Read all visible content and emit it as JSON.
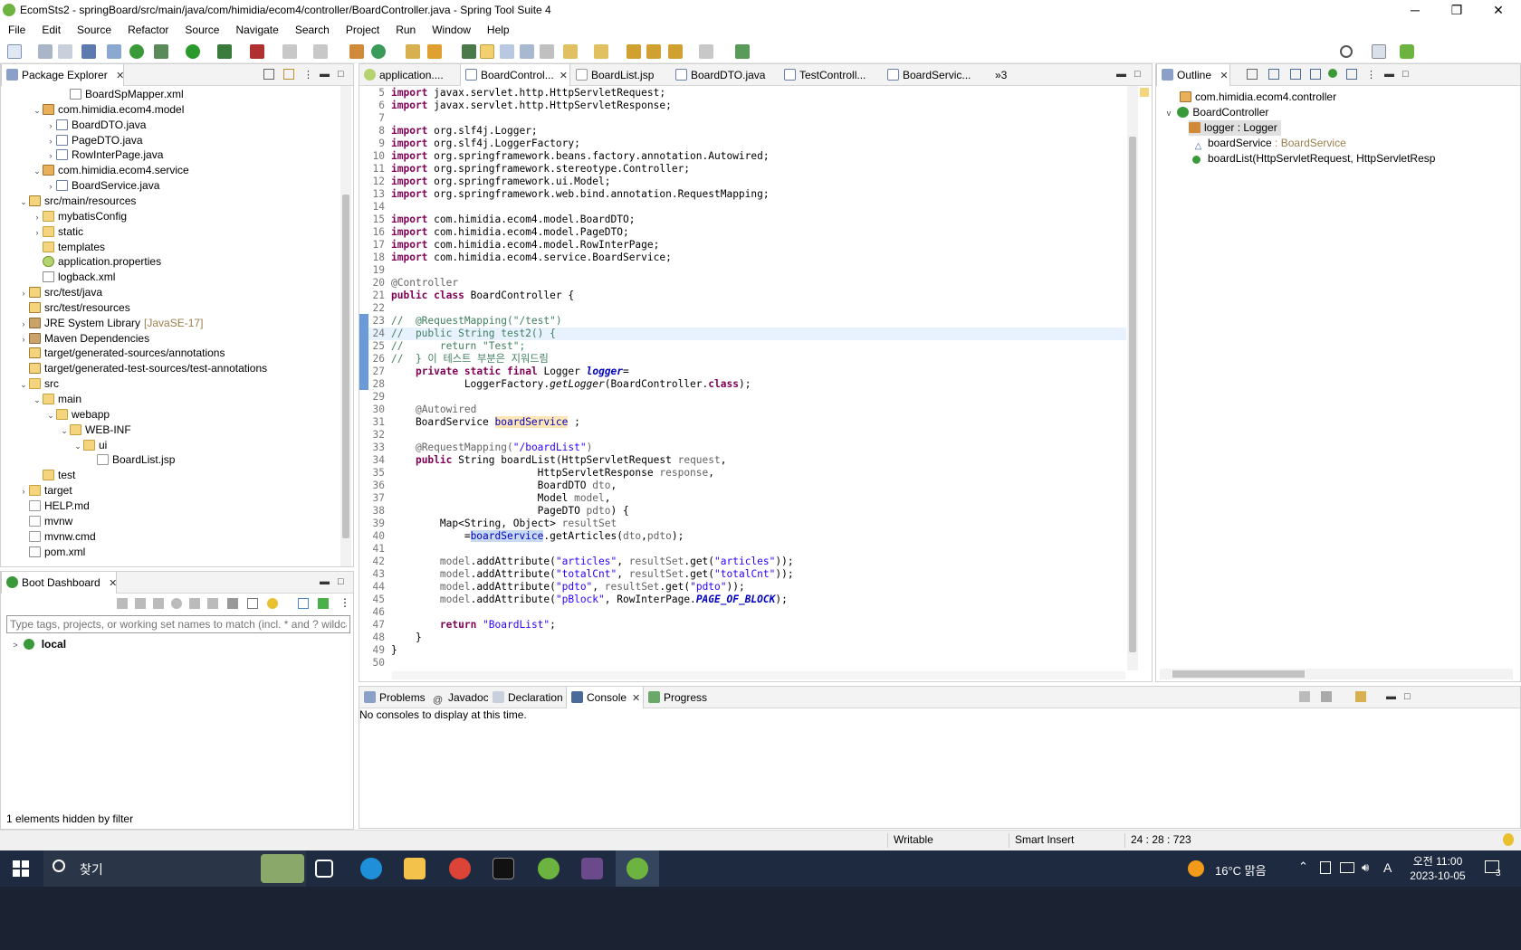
{
  "window": {
    "title": "EcomSts2 - springBoard/src/main/java/com/himidia/ecom4/controller/BoardController.java - Spring Tool Suite 4",
    "minimize": "─",
    "maximize": "❐",
    "close": "✕"
  },
  "menu": [
    "File",
    "Edit",
    "Source",
    "Refactor",
    "Source",
    "Navigate",
    "Search",
    "Project",
    "Run",
    "Window",
    "Help"
  ],
  "package_explorer": {
    "title": "Package Explorer",
    "rows": [
      {
        "label": "BoardSpMapper.xml",
        "indent": 4,
        "icon": "xml",
        "tw": ""
      },
      {
        "label": "com.himidia.ecom4.model",
        "indent": 2,
        "icon": "pkg",
        "tw": "v"
      },
      {
        "label": "BoardDTO.java",
        "indent": 3,
        "icon": "java",
        "tw": ">"
      },
      {
        "label": "PageDTO.java",
        "indent": 3,
        "icon": "java",
        "tw": ">"
      },
      {
        "label": "RowInterPage.java",
        "indent": 3,
        "icon": "java",
        "tw": ">"
      },
      {
        "label": "com.himidia.ecom4.service",
        "indent": 2,
        "icon": "pkg",
        "tw": "v"
      },
      {
        "label": "BoardService.java",
        "indent": 3,
        "icon": "java",
        "tw": ">"
      },
      {
        "label": "src/main/resources",
        "indent": 1,
        "icon": "src",
        "tw": "v"
      },
      {
        "label": "mybatisConfig",
        "indent": 2,
        "icon": "folder",
        "tw": ">"
      },
      {
        "label": "static",
        "indent": 2,
        "icon": "folder",
        "tw": ">"
      },
      {
        "label": "templates",
        "indent": 2,
        "icon": "folder",
        "tw": ""
      },
      {
        "label": "application.properties",
        "indent": 2,
        "icon": "prop",
        "tw": ""
      },
      {
        "label": "logback.xml",
        "indent": 2,
        "icon": "xml",
        "tw": ""
      },
      {
        "label": "src/test/java",
        "indent": 1,
        "icon": "src",
        "tw": ">"
      },
      {
        "label": "src/test/resources",
        "indent": 1,
        "icon": "src",
        "tw": ""
      },
      {
        "label": "JRE System Library",
        "suffix": "[JavaSE-17]",
        "indent": 1,
        "icon": "lib",
        "tw": ">"
      },
      {
        "label": "Maven Dependencies",
        "indent": 1,
        "icon": "lib",
        "tw": ">"
      },
      {
        "label": "target/generated-sources/annotations",
        "indent": 1,
        "icon": "src",
        "tw": ""
      },
      {
        "label": "target/generated-test-sources/test-annotations",
        "indent": 1,
        "icon": "src",
        "tw": ""
      },
      {
        "label": "src",
        "indent": 1,
        "icon": "folder",
        "tw": "v"
      },
      {
        "label": "main",
        "indent": 2,
        "icon": "folder",
        "tw": "v"
      },
      {
        "label": "webapp",
        "indent": 3,
        "icon": "folder",
        "tw": "v"
      },
      {
        "label": "WEB-INF",
        "indent": 4,
        "icon": "folder",
        "tw": "v"
      },
      {
        "label": "ui",
        "indent": 5,
        "icon": "folder",
        "tw": "v"
      },
      {
        "label": "BoardList.jsp",
        "indent": 6,
        "icon": "file",
        "tw": ""
      },
      {
        "label": "test",
        "indent": 2,
        "icon": "folder",
        "tw": ""
      },
      {
        "label": "target",
        "indent": 1,
        "icon": "folder",
        "tw": ">"
      },
      {
        "label": "HELP.md",
        "indent": 1,
        "icon": "file",
        "tw": ""
      },
      {
        "label": "mvnw",
        "indent": 1,
        "icon": "file",
        "tw": ""
      },
      {
        "label": "mvnw.cmd",
        "indent": 1,
        "icon": "file",
        "tw": ""
      },
      {
        "label": "pom.xml",
        "indent": 1,
        "icon": "xml",
        "tw": ""
      }
    ]
  },
  "boot_dashboard": {
    "title": "Boot Dashboard",
    "filter_placeholder": "Type tags, projects, or working set names to match (incl. * and ? wildcards)",
    "local": "local",
    "footer": "1 elements hidden by filter"
  },
  "editor_tabs": [
    "application....",
    "BoardControl...",
    "BoardList.jsp",
    "BoardDTO.java",
    "TestControll...",
    "BoardServic...",
    "»3"
  ],
  "code": [
    {
      "n": "5",
      "h": "<span class='kw'>import</span> javax.servlet.http.HttpServletRequest;"
    },
    {
      "n": "6",
      "h": "<span class='kw'>import</span> javax.servlet.http.HttpServletResponse;"
    },
    {
      "n": "7",
      "h": ""
    },
    {
      "n": "8",
      "h": "<span class='kw'>import</span> org.slf4j.Logger;"
    },
    {
      "n": "9",
      "h": "<span class='kw'>import</span> org.slf4j.LoggerFactory;"
    },
    {
      "n": "10",
      "h": "<span class='kw'>import</span> org.springframework.beans.factory.annotation.Autowired;"
    },
    {
      "n": "11",
      "h": "<span class='kw'>import</span> org.springframework.stereotype.Controller;"
    },
    {
      "n": "12",
      "h": "<span class='kw'>import</span> org.springframework.ui.Model;"
    },
    {
      "n": "13",
      "h": "<span class='kw'>import</span> org.springframework.web.bind.annotation.RequestMapping;"
    },
    {
      "n": "14",
      "h": ""
    },
    {
      "n": "15",
      "h": "<span class='kw'>import</span> com.himidia.ecom4.model.BoardDTO;"
    },
    {
      "n": "16",
      "h": "<span class='kw'>import</span> com.himidia.ecom4.model.PageDTO;"
    },
    {
      "n": "17",
      "h": "<span class='kw'>import</span> com.himidia.ecom4.model.RowInterPage;"
    },
    {
      "n": "18",
      "h": "<span class='kw'>import</span> com.himidia.ecom4.service.BoardService;"
    },
    {
      "n": "19",
      "h": ""
    },
    {
      "n": "20",
      "h": "<span class='an'>@Controller</span>"
    },
    {
      "n": "21",
      "h": "<span class='kw'>public</span> <span class='kw'>class</span> BoardController {"
    },
    {
      "n": "22",
      "h": ""
    },
    {
      "n": "23",
      "h": "<span class='cm'>//  @RequestMapping(\"/test\")</span>"
    },
    {
      "n": "24",
      "h": "<span class='cm'>//  public String test2() {</span>",
      "cur": true
    },
    {
      "n": "25",
      "h": "<span class='cm'>//      return \"Test\";</span>"
    },
    {
      "n": "26",
      "h": "<span class='cm'>//  } 이 테스트 부분은 지워드림</span>"
    },
    {
      "n": "27",
      "h": "    <span class='kw'>private</span> <span class='kw'>static</span> <span class='kw'>final</span> Logger <span class='sfld'>logger</span>="
    },
    {
      "n": "28",
      "h": "            LoggerFactory.<span class='it'>getLogger</span>(BoardController.<span class='kw'>class</span>);"
    },
    {
      "n": "29",
      "h": ""
    },
    {
      "n": "30",
      "h": "    <span class='an'>@Autowired</span>"
    },
    {
      "n": "31",
      "h": "    BoardService <span class='fld hl'>boardService</span> ;"
    },
    {
      "n": "32",
      "h": ""
    },
    {
      "n": "33",
      "h": "    <span class='an'>@RequestMapping(</span><span class='st'>\"/boardList\"</span><span class='an'>)</span>"
    },
    {
      "n": "34",
      "h": "    <span class='kw'>public</span> String boardList(HttpServletRequest <span class='an'>request</span>,"
    },
    {
      "n": "35",
      "h": "                        HttpServletResponse <span class='an'>response</span>,"
    },
    {
      "n": "36",
      "h": "                        BoardDTO <span class='an'>dto</span>,"
    },
    {
      "n": "37",
      "h": "                        Model <span class='an'>model</span>,"
    },
    {
      "n": "38",
      "h": "                        PageDTO <span class='an'>pdto</span>) {"
    },
    {
      "n": "39",
      "h": "        Map&lt;String, Object&gt; <span class='an'>resultSet</span>"
    },
    {
      "n": "40",
      "h": "            =<span class='fld sel'>boardService</span>.getArticles(<span class='an'>dto</span>,<span class='an'>pdto</span>);"
    },
    {
      "n": "41",
      "h": ""
    },
    {
      "n": "42",
      "h": "        <span class='an'>model</span>.addAttribute(<span class='st'>\"articles\"</span>, <span class='an'>resultSet</span>.get(<span class='st'>\"articles\"</span>));"
    },
    {
      "n": "43",
      "h": "        <span class='an'>model</span>.addAttribute(<span class='st'>\"totalCnt\"</span>, <span class='an'>resultSet</span>.get(<span class='st'>\"totalCnt\"</span>));"
    },
    {
      "n": "44",
      "h": "        <span class='an'>model</span>.addAttribute(<span class='st'>\"pdto\"</span>, <span class='an'>resultSet</span>.get(<span class='st'>\"pdto\"</span>));"
    },
    {
      "n": "45",
      "h": "        <span class='an'>model</span>.addAttribute(<span class='st'>\"pBlock\"</span>, RowInterPage.<span class='sfld'>PAGE_OF_BLOCK</span>);"
    },
    {
      "n": "46",
      "h": ""
    },
    {
      "n": "47",
      "h": "        <span class='kw'>return</span> <span class='st'>\"BoardList\"</span>;"
    },
    {
      "n": "48",
      "h": "    }"
    },
    {
      "n": "49",
      "h": "}"
    },
    {
      "n": "50",
      "h": ""
    }
  ],
  "outline": {
    "title": "Outline",
    "rows": [
      {
        "label": "com.himidia.ecom4.controller",
        "type": ""
      },
      {
        "label": "BoardController",
        "type": ""
      },
      {
        "label": "logger : Logger",
        "type": ""
      },
      {
        "label": "boardService",
        "type": " : BoardService"
      },
      {
        "label": "boardList(HttpServletRequest, HttpServletResp",
        "type": ""
      }
    ]
  },
  "console": {
    "tabs": [
      "Problems",
      "Javadoc",
      "Declaration",
      "Console",
      "Progress"
    ],
    "message": "No consoles to display at this time."
  },
  "status": {
    "writable": "Writable",
    "insert": "Smart Insert",
    "position": "24 : 28 : 723"
  },
  "taskbar": {
    "search": "찾기",
    "weather": "16°C  맑음",
    "time": "오전 11:00",
    "date": "2023-10-05",
    "ime": "A",
    "notif": "3"
  }
}
